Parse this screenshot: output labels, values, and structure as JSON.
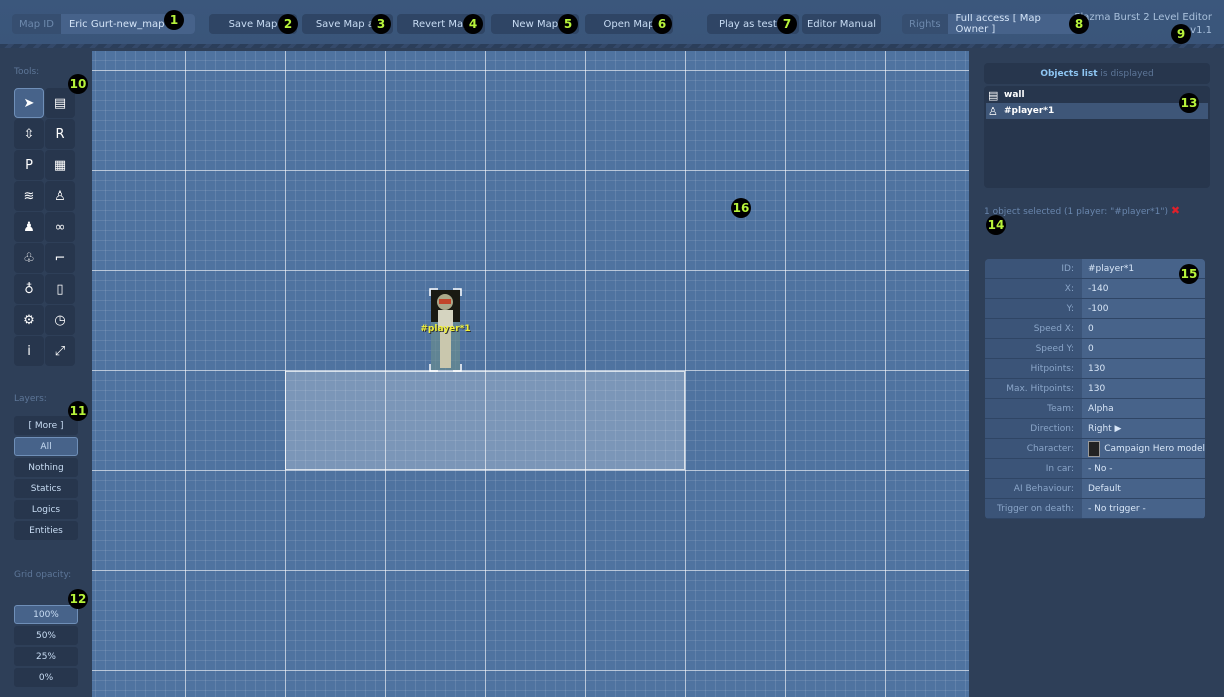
{
  "header": {
    "map_id_label": "Map ID",
    "map_id_value": "Eric Gurt-new_map",
    "save": "Save Map",
    "save_as": "Save Map as",
    "revert": "Revert Map",
    "new": "New Map",
    "open": "Open Map",
    "play": "Play as tester",
    "manual": "Editor Manual",
    "rights_label": "Rights",
    "rights_value": "Full access [ Map Owner ]",
    "app_title": "Plazma Burst 2 Level Editor",
    "version": "v1.1"
  },
  "badges": [
    "1",
    "2",
    "3",
    "4",
    "5",
    "6",
    "7",
    "8",
    "9",
    "10",
    "11",
    "12",
    "13",
    "14",
    "15",
    "16"
  ],
  "tools": {
    "label": "Tools:",
    "items": [
      {
        "name": "select",
        "glyph": "➤"
      },
      {
        "name": "wall",
        "glyph": "▤"
      },
      {
        "name": "door",
        "glyph": "⇳"
      },
      {
        "name": "region",
        "glyph": "R"
      },
      {
        "name": "pusher",
        "glyph": "P"
      },
      {
        "name": "decor",
        "glyph": "▦"
      },
      {
        "name": "water",
        "glyph": "≋"
      },
      {
        "name": "player",
        "glyph": "♙"
      },
      {
        "name": "enemy",
        "glyph": "♟"
      },
      {
        "name": "vehicle",
        "glyph": "∞"
      },
      {
        "name": "tree",
        "glyph": "♧"
      },
      {
        "name": "gun",
        "glyph": "⌐"
      },
      {
        "name": "lamp",
        "glyph": "♁"
      },
      {
        "name": "barrel",
        "glyph": "▯"
      },
      {
        "name": "trigger",
        "glyph": "⚙"
      },
      {
        "name": "timer",
        "glyph": "◷"
      },
      {
        "name": "info",
        "glyph": "i"
      },
      {
        "name": "resize",
        "glyph": "⤢"
      }
    ]
  },
  "layers": {
    "label": "Layers:",
    "items": [
      "[ More ]",
      "All",
      "Nothing",
      "Statics",
      "Logics",
      "Entities"
    ],
    "selected": "All"
  },
  "grid_opacity": {
    "label": "Grid opacity:",
    "items": [
      "100%",
      "50%",
      "25%",
      "0%"
    ],
    "selected": "100%"
  },
  "canvas": {
    "player_label": "#player*1"
  },
  "objects": {
    "title": "Objects list",
    "title_suffix": " is displayed",
    "items": [
      {
        "icon": "wall-icon",
        "glyph": "▤",
        "label": "wall"
      },
      {
        "icon": "player-icon",
        "glyph": "♙",
        "label": "#player*1",
        "selected": true
      }
    ]
  },
  "selection": {
    "text": "1 object selected (1 player: \"#player*1\")",
    "remove": "✖"
  },
  "properties": [
    {
      "k": "ID:",
      "v": "#player*1"
    },
    {
      "k": "X:",
      "v": "-140"
    },
    {
      "k": "Y:",
      "v": "-100"
    },
    {
      "k": "Speed X:",
      "v": "0"
    },
    {
      "k": "Speed Y:",
      "v": "0"
    },
    {
      "k": "Hitpoints:",
      "v": "130"
    },
    {
      "k": "Max. Hitpoints:",
      "v": "130"
    },
    {
      "k": "Team:",
      "v": "Alpha"
    },
    {
      "k": "Direction:",
      "v": "Right ▶"
    },
    {
      "k": "Character:",
      "v": "Campaign Hero model"
    },
    {
      "k": "In car:",
      "v": "- No -"
    },
    {
      "k": "AI Behaviour:",
      "v": "Default"
    },
    {
      "k": "Trigger on death:",
      "v": "- No trigger -"
    }
  ]
}
